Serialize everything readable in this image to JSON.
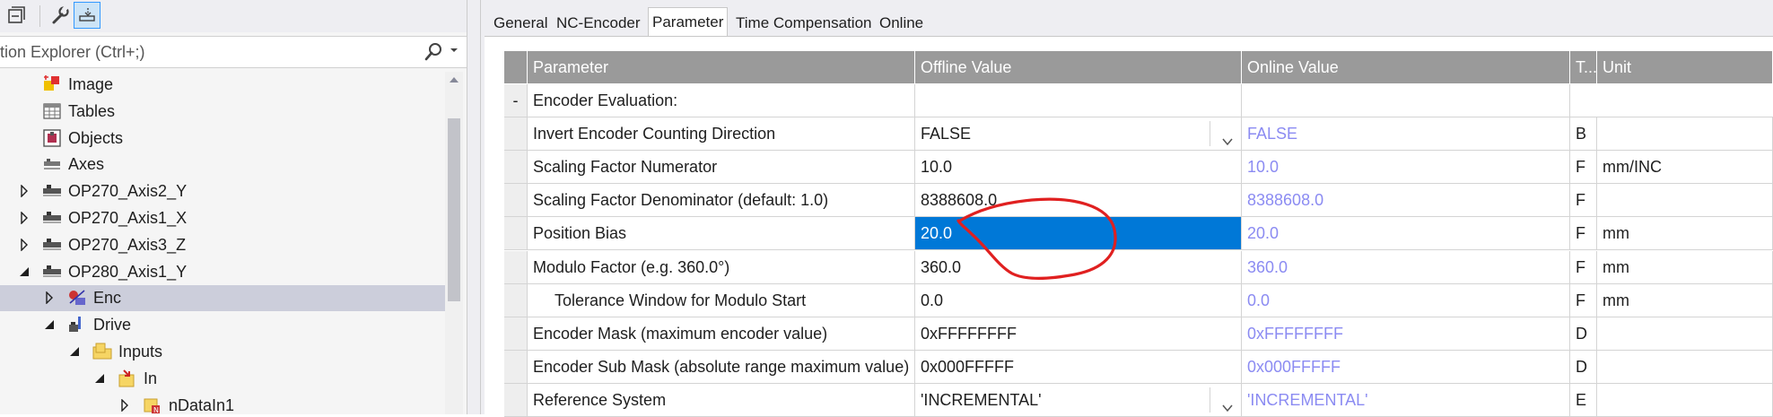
{
  "explorer": {
    "search_placeholder": "tion Explorer (Ctrl+;)",
    "tree": [
      {
        "label": "Image",
        "icon": "image-icon",
        "depth": 0,
        "expander": "none"
      },
      {
        "label": "Tables",
        "icon": "table-icon",
        "depth": 0,
        "expander": "none"
      },
      {
        "label": "Objects",
        "icon": "objects-icon",
        "depth": 0,
        "expander": "none"
      },
      {
        "label": "Axes",
        "icon": "axes-icon",
        "depth": 0,
        "expander": "none"
      },
      {
        "label": "OP270_Axis2_Y",
        "icon": "axis-icon",
        "depth": 0,
        "expander": "collapsed"
      },
      {
        "label": "OP270_Axis1_X",
        "icon": "axis-icon",
        "depth": 0,
        "expander": "collapsed"
      },
      {
        "label": "OP270_Axis3_Z",
        "icon": "axis-icon",
        "depth": 0,
        "expander": "collapsed"
      },
      {
        "label": "OP280_Axis1_Y",
        "icon": "axis-icon",
        "depth": 0,
        "expander": "expanded"
      },
      {
        "label": "Enc",
        "icon": "encoder-icon",
        "depth": 1,
        "expander": "collapsed",
        "selected": true
      },
      {
        "label": "Drive",
        "icon": "drive-icon",
        "depth": 1,
        "expander": "expanded"
      },
      {
        "label": "Inputs",
        "icon": "folder-icon",
        "depth": 2,
        "expander": "expanded"
      },
      {
        "label": "In",
        "icon": "input-icon",
        "depth": 3,
        "expander": "expanded"
      },
      {
        "label": "nDataIn1",
        "icon": "variable-icon",
        "depth": 4,
        "expander": "collapsed"
      }
    ]
  },
  "tabs": [
    {
      "label": "General",
      "active": false
    },
    {
      "label": "NC-Encoder",
      "active": false
    },
    {
      "label": "Parameter",
      "active": true
    },
    {
      "label": "Time Compensation",
      "active": false
    },
    {
      "label": "Online",
      "active": false
    }
  ],
  "grid": {
    "headers": [
      "Parameter",
      "Offline Value",
      "Online Value",
      "T...",
      "Unit"
    ],
    "rows": [
      {
        "gutter": "-",
        "param": "Encoder Evaluation:",
        "offline": "",
        "online": "",
        "type": "",
        "unit": "",
        "group": true
      },
      {
        "gutter": "",
        "param": "Invert Encoder Counting Direction",
        "offline": "FALSE",
        "online": "FALSE",
        "type": "B",
        "unit": "",
        "dropdown": true
      },
      {
        "gutter": "",
        "param": "Scaling Factor Numerator",
        "offline": "10.0",
        "online": "10.0",
        "type": "F",
        "unit": "mm/INC"
      },
      {
        "gutter": "",
        "param": "Scaling Factor Denominator (default: 1.0)",
        "offline": "8388608.0",
        "online": "8388608.0",
        "type": "F",
        "unit": ""
      },
      {
        "gutter": "",
        "param": "Position Bias",
        "offline": "20.0",
        "online": "20.0",
        "type": "F",
        "unit": "mm",
        "selected": true
      },
      {
        "gutter": "",
        "param": "Modulo Factor (e.g. 360.0°)",
        "offline": "360.0",
        "online": "360.0",
        "type": "F",
        "unit": "mm"
      },
      {
        "gutter": "",
        "param": "Tolerance Window for Modulo Start",
        "offline": "0.0",
        "online": "0.0",
        "type": "F",
        "unit": "mm",
        "indent": true
      },
      {
        "gutter": "",
        "param": "Encoder Mask (maximum encoder value)",
        "offline": "0xFFFFFFFF",
        "online": "0xFFFFFFFF",
        "type": "D",
        "unit": ""
      },
      {
        "gutter": "",
        "param": "Encoder Sub Mask (absolute range maximum value)",
        "offline": "0x000FFFFF",
        "online": "0x000FFFFF",
        "type": "D",
        "unit": ""
      },
      {
        "gutter": "",
        "param": "Reference System",
        "offline": "'INCREMENTAL'",
        "online": "'INCREMENTAL'",
        "type": "E",
        "unit": "",
        "dropdown": true
      }
    ]
  },
  "colors": {
    "selection": "#0078d7",
    "online_value": "#8b8bf2",
    "header_bg": "#9a9a9a",
    "tree_selection": "#cccedb",
    "annotation": "#e02020"
  }
}
